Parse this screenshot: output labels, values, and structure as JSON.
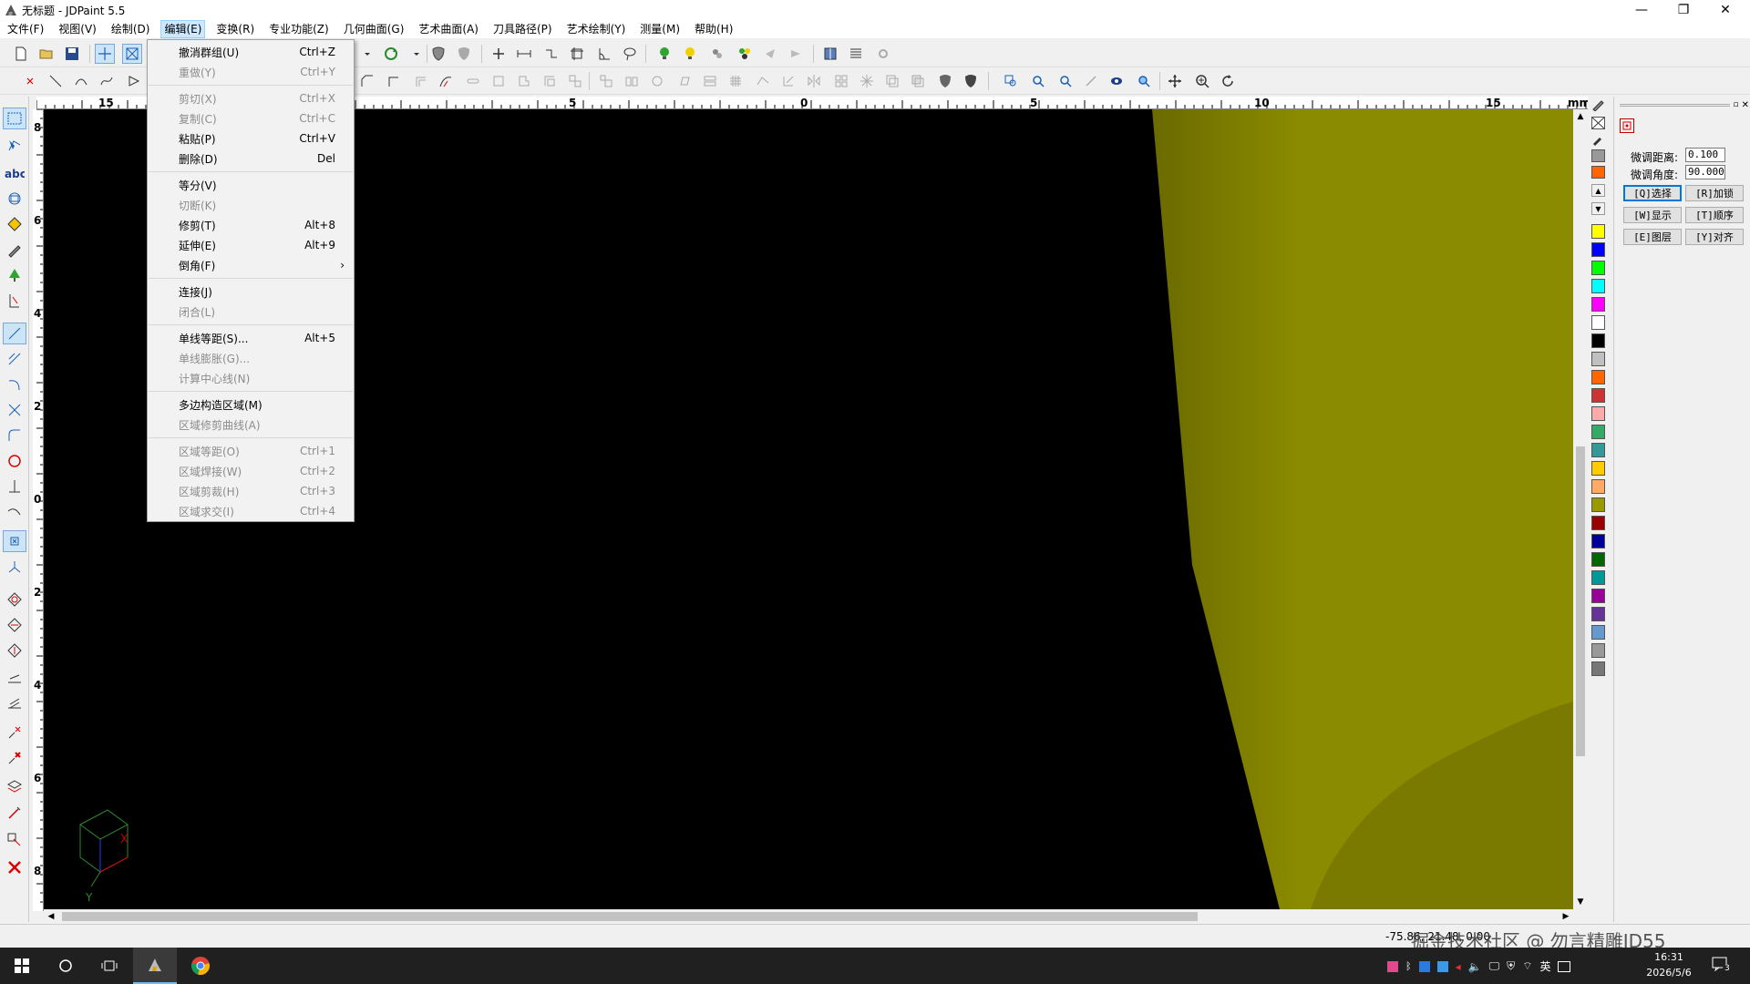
{
  "window": {
    "title": "无标题 - JDPaint 5.5",
    "app_icon": "jdpaint-app-icon",
    "controls": {
      "minimize": "—",
      "restore": "❐",
      "close": "✕"
    }
  },
  "menubar": [
    "文件(F)",
    "视图(V)",
    "绘制(D)",
    "编辑(E)",
    "变换(R)",
    "专业功能(Z)",
    "几何曲面(G)",
    "艺术曲面(A)",
    "刀具路径(P)",
    "艺术绘制(Y)",
    "测量(M)",
    "帮助(H)"
  ],
  "active_menu": "编辑(E)",
  "edit_menu": {
    "groups": [
      [
        {
          "label": "撤消群组(U)",
          "shortcut": "Ctrl+Z",
          "enabled": true
        },
        {
          "label": "重做(Y)",
          "shortcut": "Ctrl+Y",
          "enabled": false
        }
      ],
      [
        {
          "label": "剪切(X)",
          "shortcut": "Ctrl+X",
          "enabled": false
        },
        {
          "label": "复制(C)",
          "shortcut": "Ctrl+C",
          "enabled": false
        },
        {
          "label": "粘贴(P)",
          "shortcut": "Ctrl+V",
          "enabled": true
        },
        {
          "label": "删除(D)",
          "shortcut": "Del",
          "enabled": true
        }
      ],
      [
        {
          "label": "等分(V)",
          "shortcut": "",
          "enabled": true
        },
        {
          "label": "切断(K)",
          "shortcut": "",
          "enabled": false
        },
        {
          "label": "修剪(T)",
          "shortcut": "Alt+8",
          "enabled": true
        },
        {
          "label": "延伸(E)",
          "shortcut": "Alt+9",
          "enabled": true
        },
        {
          "label": "倒角(F)",
          "shortcut": "",
          "enabled": true,
          "submenu": true
        }
      ],
      [
        {
          "label": "连接(J)",
          "shortcut": "",
          "enabled": true
        },
        {
          "label": "闭合(L)",
          "shortcut": "",
          "enabled": false
        }
      ],
      [
        {
          "label": "单线等距(S)...",
          "shortcut": "Alt+5",
          "enabled": true
        },
        {
          "label": "单线膨胀(G)...",
          "shortcut": "",
          "enabled": false
        },
        {
          "label": "计算中心线(N)",
          "shortcut": "",
          "enabled": false
        }
      ],
      [
        {
          "label": "多边构造区域(M)",
          "shortcut": "",
          "enabled": true
        },
        {
          "label": "区域修剪曲线(A)",
          "shortcut": "",
          "enabled": false
        }
      ],
      [
        {
          "label": "区域等距(O)",
          "shortcut": "Ctrl+1",
          "enabled": false
        },
        {
          "label": "区域焊接(W)",
          "shortcut": "Ctrl+2",
          "enabled": false
        },
        {
          "label": "区域剪裁(H)",
          "shortcut": "Ctrl+3",
          "enabled": false
        },
        {
          "label": "区域求交(I)",
          "shortcut": "Ctrl+4",
          "enabled": false
        }
      ]
    ],
    "submenu_arrow": "›"
  },
  "ruler": {
    "unit": "mm",
    "h_labels": [
      "15",
      "5",
      "0",
      "5",
      "10",
      "15"
    ],
    "v_labels": [
      "8",
      "6",
      "4",
      "2",
      "0",
      "2",
      "4",
      "6",
      "8"
    ]
  },
  "right_panel": {
    "nudge_distance_label": "微调距离:",
    "nudge_distance_value": "0.100",
    "nudge_angle_label": "微调角度:",
    "nudge_angle_value": "90.000",
    "buttons": [
      "[Q]选择",
      "[R]加锁",
      "[W]显示",
      "[T]顺序",
      "[E]图层",
      "[Y]对齐"
    ]
  },
  "palette_colors": [
    "#ffff00",
    "#0000ff",
    "#00ff00",
    "#00ffff",
    "#ff00ff",
    "#ffffff",
    "#000000",
    "#c0c0c0",
    "#ff6600",
    "#cc3333",
    "#ffaaaa",
    "#33aa66",
    "#339999",
    "#ffcc00",
    "#ffaa66",
    "#999900",
    "#990000",
    "#000099",
    "#006600",
    "#009999",
    "#990099",
    "#663399",
    "#6699cc",
    "#999999",
    "#777777"
  ],
  "viewport": {
    "background": "#000000",
    "surface_color": "#8b8b00",
    "axis_gizmo": {
      "y_label": "Y",
      "x_label": "X"
    }
  },
  "statusbar": {
    "coords": "-75.86, 21.48, 0.00"
  },
  "watermark": "掘金技术社区 @ 勿言精雕JD55",
  "taskbar": {
    "ime": "英",
    "time": "16:31",
    "date": "2026/5/6",
    "notification_count": "3"
  }
}
